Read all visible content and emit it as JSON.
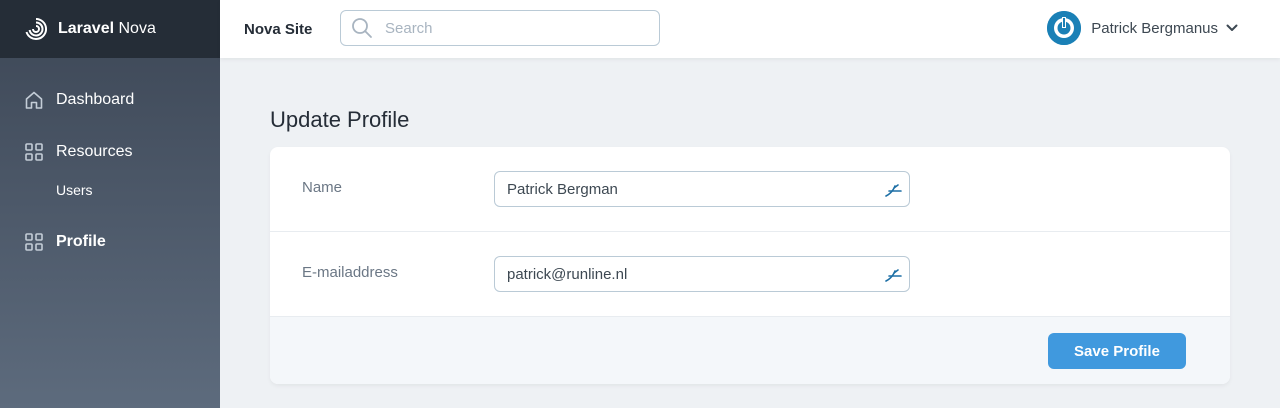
{
  "app": {
    "brand_bold": "Laravel",
    "brand_rest": " Nova",
    "site_name": "Nova Site"
  },
  "search": {
    "placeholder": "Search"
  },
  "user": {
    "name": "Patrick Bergmanus"
  },
  "sidebar": {
    "items": [
      {
        "label": "Dashboard",
        "icon": "home-icon"
      },
      {
        "label": "Resources",
        "icon": "grid-icon"
      },
      {
        "label": "Users"
      },
      {
        "label": "Profile",
        "icon": "grid-icon"
      }
    ]
  },
  "page": {
    "title": "Update Profile"
  },
  "form": {
    "fields": [
      {
        "label": "Name",
        "value": "Patrick Bergman"
      },
      {
        "label": "E-mailaddress",
        "value": "patrick@runline.nl"
      }
    ],
    "save_label": "Save Profile"
  },
  "colors": {
    "accent": "#4099de",
    "sidebar_top": "#3c4655",
    "brand_bar": "#252d37",
    "avatar": "#1a80b6"
  }
}
